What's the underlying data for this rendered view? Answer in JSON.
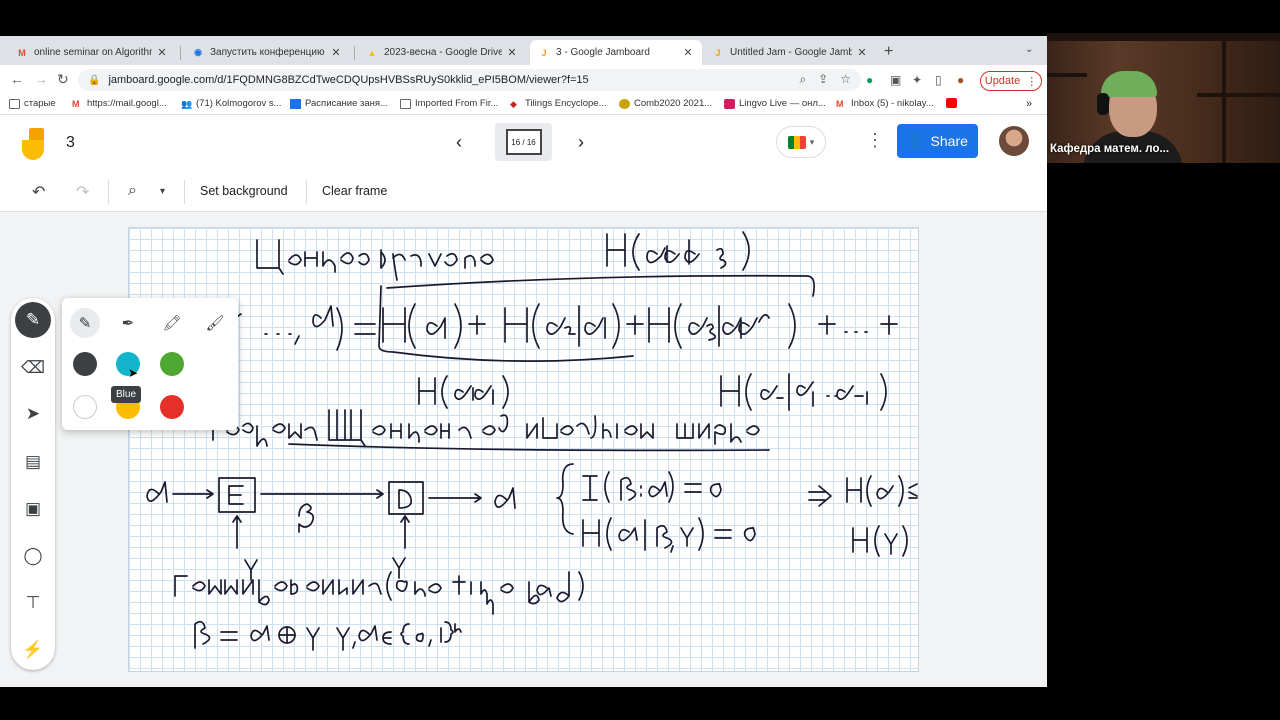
{
  "tabs": [
    {
      "title": "online seminar on Algorithmic",
      "icon": "gmail-icon",
      "active": false
    },
    {
      "title": "Запустить конференцию - Zo",
      "icon": "chrome-icon",
      "active": false
    },
    {
      "title": "2023-весна - Google Drive",
      "icon": "drive-icon",
      "active": false
    },
    {
      "title": "3 - Google Jamboard",
      "icon": "jamboard-icon",
      "active": true
    },
    {
      "title": "Untitled Jam - Google Jamboa",
      "icon": "jamboard-icon",
      "active": false
    }
  ],
  "address": {
    "url": "jamboard.google.com/d/1FQDMNG8BZCdTweCDQUpsHVBSsRUyS0kklid_ePI5BOM/viewer?f=15"
  },
  "update_label": "Update",
  "bookmarks": [
    "старые",
    "https://mail.googl...",
    "(71) Kolmogorov s...",
    "Расписание заня...",
    "Imported From Fir...",
    "Tilings Encyclope...",
    "Comb2020 2021...",
    "Lingvo Live — онл...",
    "Inbox (5) - nikolay..."
  ],
  "jamboard": {
    "title": "3",
    "frame_counter": "16 / 16",
    "share_label": "Share",
    "toolbar": {
      "set_background": "Set background",
      "clear_frame": "Clear frame"
    },
    "pen_colors": [
      {
        "name": "Black",
        "hex": "#3c4043"
      },
      {
        "name": "Blue",
        "hex": "#12b5cb"
      },
      {
        "name": "Green",
        "hex": "#4ea832"
      },
      {
        "name": "White",
        "hex": "#ffffff"
      },
      {
        "name": "Yellow",
        "hex": "#fbbc04"
      },
      {
        "name": "Red",
        "hex": "#e52f28"
      }
    ],
    "tooltip": "Blue"
  },
  "video": {
    "participant_label": "Кафедра матем. ло..."
  },
  "colors": {
    "accent": "#1a73e8",
    "update_red": "#d93025",
    "ink": "#1a1a2e"
  }
}
